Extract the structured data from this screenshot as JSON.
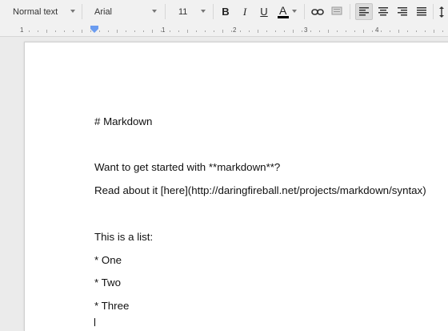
{
  "toolbar": {
    "style_select": "Normal text",
    "font_select": "Arial",
    "size_select": "11",
    "bold": "B",
    "italic": "I",
    "underline": "U",
    "text_color": "A",
    "text_color_bar": "#000000",
    "active_button_bg": "#dcdcdc"
  },
  "ruler": {
    "numbers": [
      "1",
      "1",
      "2",
      "3",
      "4"
    ]
  },
  "document": {
    "lines": [
      "# Markdown",
      "Want to get started with **markdown**?",
      "Read about it [here](http://daringfireball.net/projects/markdown/syntax)",
      "This is a list:",
      "* One",
      "* Two",
      "* Three"
    ]
  }
}
